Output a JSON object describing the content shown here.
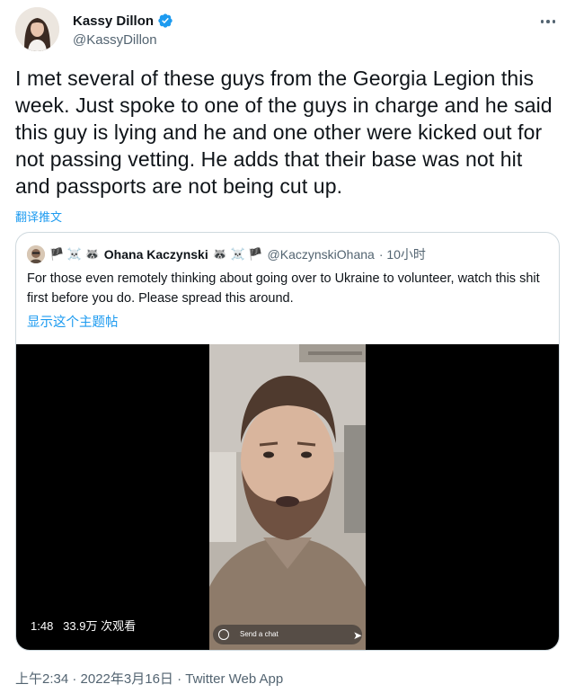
{
  "author": {
    "display_name": "Kassy Dillon",
    "handle": "@KassyDillon",
    "verified": true
  },
  "tweet": {
    "text": "I met several of these guys from the Georgia Legion this week. Just spoke to one of the guys in charge and he said this guy is lying and he and one other were kicked out for not passing vetting. He adds that their base was not hit and passports are not being cut up.",
    "translate_label": "翻译推文"
  },
  "quote": {
    "name_prefix_flags": "🏴 ☠️ 🦝",
    "display_name": "Ohana Kaczynski",
    "name_suffix_flags": "🦝 ☠️ 🏴",
    "handle": "@KaczynskiOhana",
    "time": "· 10小时",
    "text": "For those even remotely thinking about going over to Ukraine to volunteer, watch this shit first before you do. Please spread this around.",
    "show_thread": "显示这个主题帖"
  },
  "video": {
    "duration": "1:48",
    "views": "33.9万 次观看",
    "overlay_text": "Send a chat"
  },
  "footer": {
    "timestamp": "上午2:34 · 2022年3月16日 · ",
    "app": "Twitter Web App"
  },
  "colors": {
    "accent": "#1d9bf0",
    "secondary_text": "#536471",
    "border": "#cfd9de"
  }
}
